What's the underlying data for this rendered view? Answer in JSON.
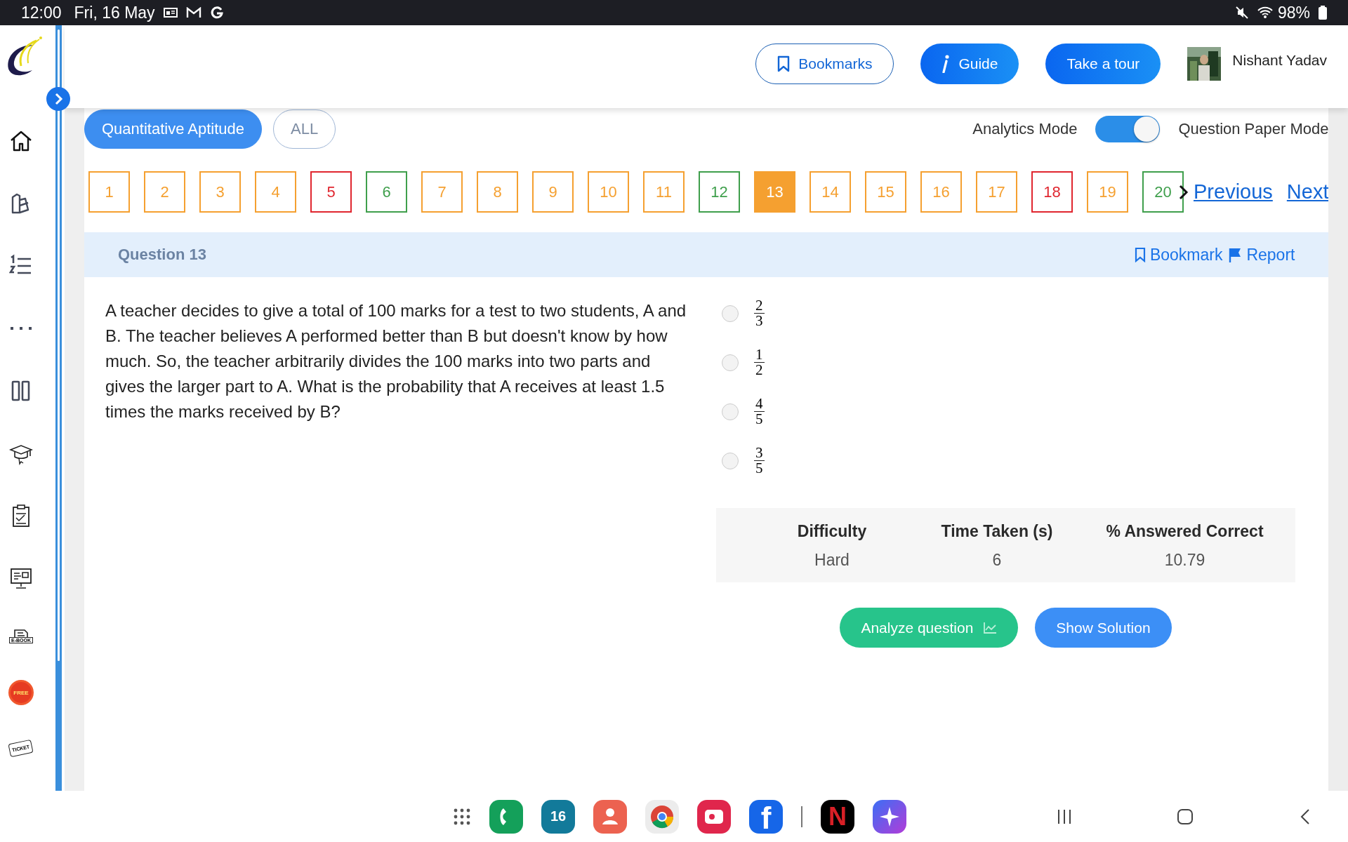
{
  "status_bar": {
    "time": "12:00",
    "date": "Fri, 16 May",
    "battery": "98%"
  },
  "sidebar": {
    "ebook_label": "E-BOOK",
    "free_label": "FREE",
    "ticket_label": "TICKET"
  },
  "header": {
    "buttons": [
      {
        "label": "Bookmarks",
        "kind": "outline"
      },
      {
        "label": "Guide",
        "kind": "info"
      },
      {
        "label": "Take a tour",
        "kind": "primary"
      }
    ],
    "user": "Nishant Yadav"
  },
  "subjects": [
    {
      "label": "Quantitative Aptitude",
      "selected": true
    },
    {
      "label": "ALL",
      "selected": false
    }
  ],
  "mode_switch": {
    "left_label": "Analytics Mode",
    "right_label": "Question Paper Mode",
    "on": true
  },
  "question_nav": {
    "items": [
      {
        "label": "1",
        "color": "#f5a030",
        "selected": false
      },
      {
        "label": "2",
        "color": "#f5a030",
        "selected": false
      },
      {
        "label": "3",
        "color": "#f5a030",
        "selected": false
      },
      {
        "label": "4",
        "color": "#f5a030",
        "selected": false
      },
      {
        "label": "5",
        "color": "#e0262f",
        "selected": false
      },
      {
        "label": "6",
        "color": "#3f9f4c",
        "selected": false
      },
      {
        "label": "7",
        "color": "#f5a030",
        "selected": false
      },
      {
        "label": "8",
        "color": "#f5a030",
        "selected": false
      },
      {
        "label": "9",
        "color": "#f5a030",
        "selected": false
      },
      {
        "label": "10",
        "color": "#f5a030",
        "selected": false
      },
      {
        "label": "11",
        "color": "#f5a030",
        "selected": false
      },
      {
        "label": "12",
        "color": "#3f9f4c",
        "selected": false
      },
      {
        "label": "13",
        "color": "#f5a030",
        "selected": true
      },
      {
        "label": "14",
        "color": "#f5a030",
        "selected": false
      },
      {
        "label": "15",
        "color": "#f5a030",
        "selected": false
      },
      {
        "label": "16",
        "color": "#f5a030",
        "selected": false
      },
      {
        "label": "17",
        "color": "#f5a030",
        "selected": false
      },
      {
        "label": "18",
        "color": "#e0262f",
        "selected": false
      },
      {
        "label": "19",
        "color": "#f5a030",
        "selected": false
      },
      {
        "label": "20",
        "color": "#3f9f4c",
        "selected": false
      }
    ],
    "previous": "Previous",
    "next": "Next"
  },
  "question": {
    "title": "Question 13",
    "bookmark": "Bookmark",
    "report": "Report",
    "text": "A teacher decides to give a total of 100 marks for a test to two students, A and B. The teacher believes A performed better than B but doesn't know by how much. So, the teacher arbitrarily divides the 100 marks into two parts and gives the larger part to A. What is the probability that A receives at least 1.5 times the marks received by B?",
    "options": [
      {
        "numerator": "2",
        "denominator": "3",
        "selected": false
      },
      {
        "numerator": "1",
        "denominator": "2",
        "selected": false
      },
      {
        "numerator": "4",
        "denominator": "5",
        "selected": false
      },
      {
        "numerator": "3",
        "denominator": "5",
        "selected": false
      }
    ]
  },
  "stats": {
    "columns": [
      "Difficulty",
      "Time Taken (s)",
      "% Answered Correct"
    ],
    "values": [
      "Hard",
      "6",
      "10.79"
    ]
  },
  "actions": [
    {
      "label": "Analyze question",
      "kind": "analyze"
    },
    {
      "label": "Show Solution",
      "kind": "solution"
    }
  ],
  "taskbar": {
    "calendar_day": "16",
    "netflix": "N",
    "facebook": "f"
  }
}
